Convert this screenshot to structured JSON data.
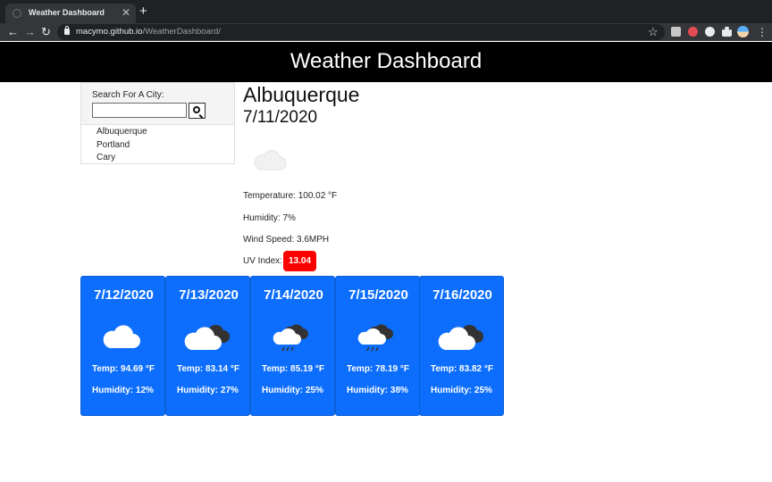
{
  "browser": {
    "tab_title": "Weather Dashboard",
    "tab_close": "✕",
    "new_tab": "+",
    "url_host": "macymo.github.io",
    "url_path": "/WeatherDashboard/",
    "back": "←",
    "forward": "→",
    "reload": "↻",
    "star": "☆",
    "menu": "⋮"
  },
  "header": {
    "title": "Weather Dashboard"
  },
  "search": {
    "label": "Search For A City:",
    "input_value": "",
    "history": [
      "Albuquerque",
      "Portland",
      "Cary"
    ]
  },
  "current": {
    "city": "Albuquerque",
    "date": "7/11/2020",
    "icon": "cloud-icon",
    "temperature": "Temperature: 100.02 °F",
    "humidity": "Humidity: 7%",
    "wind": "Wind Speed: 3.6MPH",
    "uv_label": "UV Index:",
    "uv_value": "13.04",
    "uv_color": "#ff0000"
  },
  "forecast": [
    {
      "date": "7/12/2020",
      "icon": "cloud-icon",
      "temp": "Temp: 94.69 °F",
      "humidity": "Humidity: 12%"
    },
    {
      "date": "7/13/2020",
      "icon": "broken-clouds-icon",
      "temp": "Temp: 83.14 °F",
      "humidity": "Humidity: 27%"
    },
    {
      "date": "7/14/2020",
      "icon": "rain-icon",
      "temp": "Temp: 85.19 °F",
      "humidity": "Humidity: 25%"
    },
    {
      "date": "7/15/2020",
      "icon": "rain-icon",
      "temp": "Temp: 78.19 °F",
      "humidity": "Humidity: 38%"
    },
    {
      "date": "7/16/2020",
      "icon": "broken-clouds-icon",
      "temp": "Temp: 83.82 °F",
      "humidity": "Humidity: 25%"
    }
  ],
  "colors": {
    "forecast_card": "#0d6efd",
    "header_bg": "#000000"
  }
}
